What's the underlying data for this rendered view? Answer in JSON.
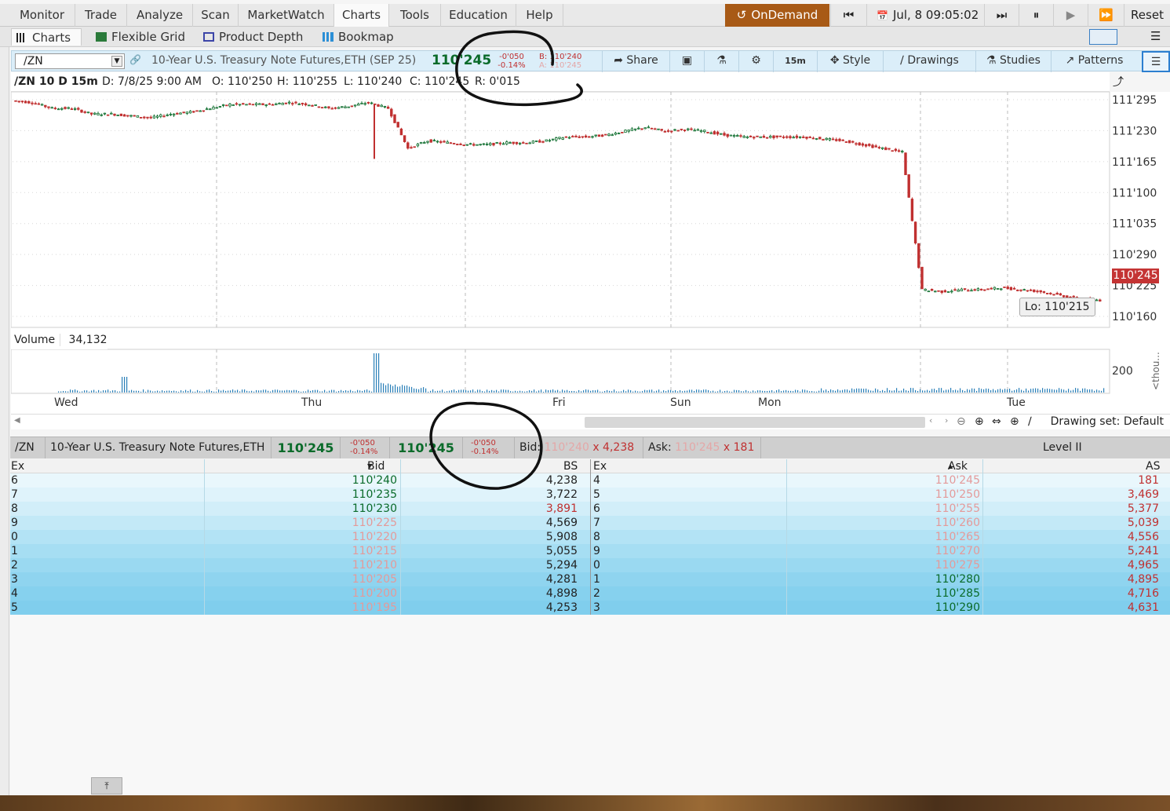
{
  "menu": {
    "items": [
      "Monitor",
      "Trade",
      "Analyze",
      "Scan",
      "MarketWatch",
      "Charts",
      "Tools",
      "Education",
      "Help"
    ],
    "active": "Charts",
    "ondemand": "OnDemand",
    "datetime": "Jul, 8 09:05:02",
    "reset": "Reset"
  },
  "tabs": [
    "Charts",
    "Flexible Grid",
    "Product Depth",
    "Bookmap"
  ],
  "chart_toolbar": {
    "symbol": "/ZN",
    "description": "10-Year U.S. Treasury Note Futures,ETH (SEP 25)",
    "last": "110'245",
    "change": "-0'050",
    "change_pct": "-0.14%",
    "bid_label": "B:",
    "bid": "110'240",
    "ask_label": "A:",
    "ask": "110'245",
    "share": "Share",
    "timeframe": "15m",
    "style": "Style",
    "drawings": "Drawings",
    "studies": "Studies",
    "patterns": "Patterns"
  },
  "chart_header": {
    "title": "/ZN 10 D 15m",
    "date": "D: 7/8/25 9:00 AM",
    "open": "O: 110'250",
    "high": "H: 110'255",
    "low": "L: 110'240",
    "close": "C: 110'245",
    "range": "R: 0'015"
  },
  "price_axis": [
    "111'295",
    "111'230",
    "111'165",
    "111'100",
    "111'035",
    "110'290",
    "110'225",
    "110'160"
  ],
  "current_price_tag": "110'245",
  "low_label": "Lo: 110'215",
  "volume": {
    "label": "Volume",
    "value": "34,132",
    "axis": "200",
    "unit_label": "<thou..."
  },
  "x_axis_days": [
    "Wed",
    "Thu",
    "Fri",
    "Sun",
    "Mon",
    "Tue"
  ],
  "drawing_set": "Drawing set: Default",
  "chart_data": {
    "type": "line",
    "title": "/ZN 10 D 15m",
    "x": [
      "Wed",
      "Thu",
      "Fri",
      "Sun",
      "Mon",
      "Tue"
    ],
    "series": [
      {
        "values": [
          111.29,
          111.28,
          111.25,
          111.25,
          111.22,
          111.22,
          111.21,
          111.2,
          111.22,
          111.23,
          111.25,
          111.27,
          111.27,
          111.27,
          111.28,
          111.27,
          111.25,
          111.26,
          111.28,
          111.25,
          111.04,
          111.08,
          111.07,
          111.06,
          111.06,
          111.07,
          111.07,
          111.08,
          111.1,
          111.1,
          111.11,
          111.13,
          111.15,
          111.13,
          111.14,
          111.13,
          111.11,
          111.1,
          111.1,
          111.1,
          111.1,
          111.09,
          111.08,
          111.06,
          111.04,
          111.02,
          110.3,
          110.29,
          110.3,
          110.3,
          110.31,
          110.3,
          110.29,
          110.27,
          110.25,
          110.245
        ]
      }
    ],
    "ylim": [
      110.16,
      111.295
    ]
  },
  "quote_bar": {
    "symbol": "/ZN",
    "description": "10-Year U.S. Treasury Note Futures,ETH",
    "last": "110'245",
    "change": "-0'050",
    "change_pct": "-0.14%",
    "last2": "110'245",
    "change2": "-0'050",
    "change_pct2": "-0.14%",
    "bid_label": "Bid:",
    "bid": "110'240",
    "bid_size": "x 4,238",
    "ask_label": "Ask:",
    "ask": "110'245",
    "ask_size": "x 181",
    "level": "Level II"
  },
  "level2": {
    "headers": {
      "ex": "Ex",
      "bid": "Bid",
      "bs": "BS",
      "ex2": "Ex",
      "ask": "Ask",
      "as": "AS"
    },
    "rows": [
      {
        "ex": "6",
        "bid": "110'240",
        "bs": "4,238",
        "ex2": "4",
        "ask": "110'245",
        "as": "181"
      },
      {
        "ex": "7",
        "bid": "110'235",
        "bs": "3,722",
        "ex2": "5",
        "ask": "110'250",
        "as": "3,469"
      },
      {
        "ex": "8",
        "bid": "110'230",
        "bs": "3,891",
        "ex2": "6",
        "ask": "110'255",
        "as": "5,377"
      },
      {
        "ex": "9",
        "bid": "110'225",
        "bs": "4,569",
        "ex2": "7",
        "ask": "110'260",
        "as": "5,039"
      },
      {
        "ex": "0",
        "bid": "110'220",
        "bs": "5,908",
        "ex2": "8",
        "ask": "110'265",
        "as": "4,556"
      },
      {
        "ex": "1",
        "bid": "110'215",
        "bs": "5,055",
        "ex2": "9",
        "ask": "110'270",
        "as": "5,241"
      },
      {
        "ex": "2",
        "bid": "110'210",
        "bs": "5,294",
        "ex2": "0",
        "ask": "110'275",
        "as": "4,965"
      },
      {
        "ex": "3",
        "bid": "110'205",
        "bs": "4,281",
        "ex2": "1",
        "ask": "110'280",
        "as": "4,895"
      },
      {
        "ex": "4",
        "bid": "110'200",
        "bs": "4,898",
        "ex2": "2",
        "ask": "110'285",
        "as": "4,716"
      },
      {
        "ex": "5",
        "bid": "110'195",
        "bs": "4,253",
        "ex2": "3",
        "ask": "110'290",
        "as": "4,631"
      }
    ]
  },
  "colors": {
    "up": "#0a6b2a",
    "down": "#c03030",
    "accent": "#a85a16",
    "row_shades": [
      "#e9f7fc",
      "#dff3fb",
      "#d2eef9",
      "#c3e9f7",
      "#b3e3f5",
      "#a6def3",
      "#9ad9f1",
      "#8fd4ef",
      "#86d1ee",
      "#80ceed"
    ]
  }
}
